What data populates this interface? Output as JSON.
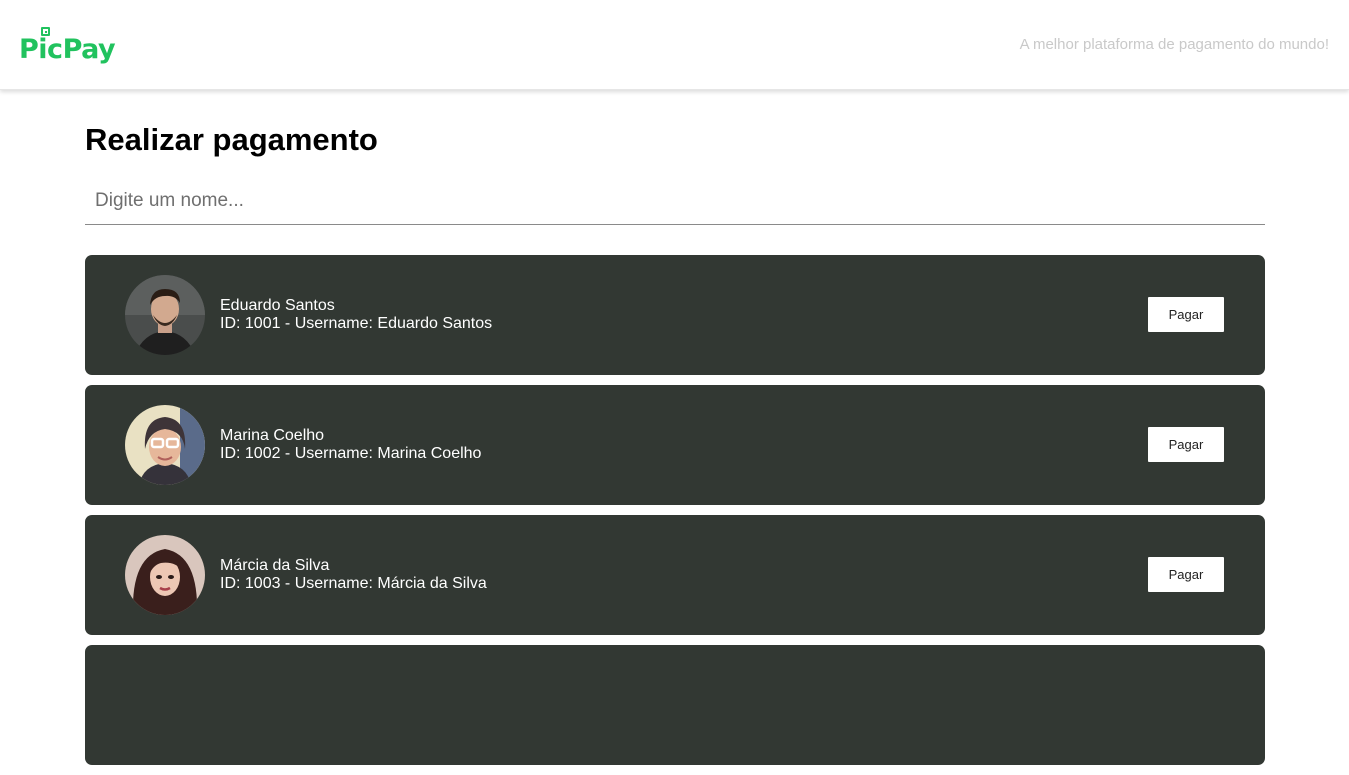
{
  "brand": {
    "logo_part1": "Pic",
    "logo_part2": "Pay",
    "logo_color": "#21c25e"
  },
  "header": {
    "tagline": "A melhor plataforma de pagamento do mundo!"
  },
  "page": {
    "title": "Realizar pagamento",
    "search_placeholder": "Digite um nome..."
  },
  "card_color": "#323833",
  "users": [
    {
      "name": "Eduardo Santos",
      "details": "ID: 1001 - Username: Eduardo Santos",
      "button": "Pagar",
      "avatar": "man-portrait"
    },
    {
      "name": "Marina Coelho",
      "details": "ID: 1002 - Username: Marina Coelho",
      "button": "Pagar",
      "avatar": "woman-glasses-portrait"
    },
    {
      "name": "Márcia da Silva",
      "details": "ID: 1003 - Username: Márcia da Silva",
      "button": "Pagar",
      "avatar": "woman-portrait"
    }
  ]
}
